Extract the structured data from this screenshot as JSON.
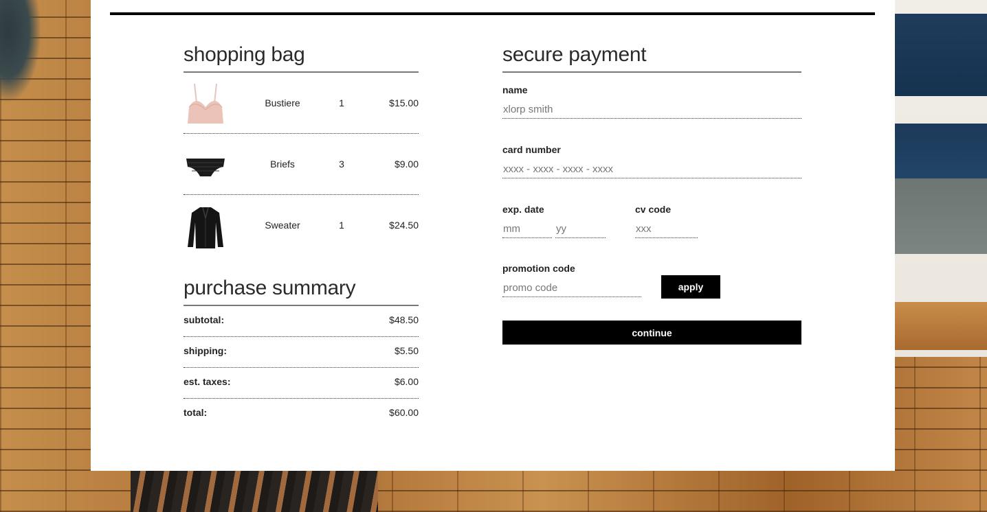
{
  "bag": {
    "title": "shopping bag",
    "items": [
      {
        "name": "Bustiere",
        "qty": "1",
        "price": "$15.00",
        "thumb": "bustier-icon"
      },
      {
        "name": "Briefs",
        "qty": "3",
        "price": "$9.00",
        "thumb": "briefs-icon"
      },
      {
        "name": "Sweater",
        "qty": "1",
        "price": "$24.50",
        "thumb": "sweater-icon"
      }
    ]
  },
  "summary": {
    "title": "purchase summary",
    "rows": [
      {
        "label": "subtotal:",
        "value": "$48.50"
      },
      {
        "label": "shipping:",
        "value": "$5.50"
      },
      {
        "label": "est. taxes:",
        "value": "$6.00"
      },
      {
        "label": "total:",
        "value": "$60.00"
      }
    ]
  },
  "payment": {
    "title": "secure payment",
    "name_label": "name",
    "name_placeholder": "xlorp smith",
    "card_label": "card number",
    "card_placeholder": "xxxx - xxxx - xxxx - xxxx",
    "exp_label": "exp. date",
    "exp_month_placeholder": "mm",
    "exp_year_placeholder": "yy",
    "cv_label": "cv code",
    "cv_placeholder": "xxx",
    "promo_label": "promotion code",
    "promo_placeholder": "promo code",
    "apply_label": "apply",
    "continue_label": "continue"
  },
  "colors": {
    "button_bg": "#000000",
    "button_text": "#ffffff",
    "panel_bg": "#ffffff"
  }
}
